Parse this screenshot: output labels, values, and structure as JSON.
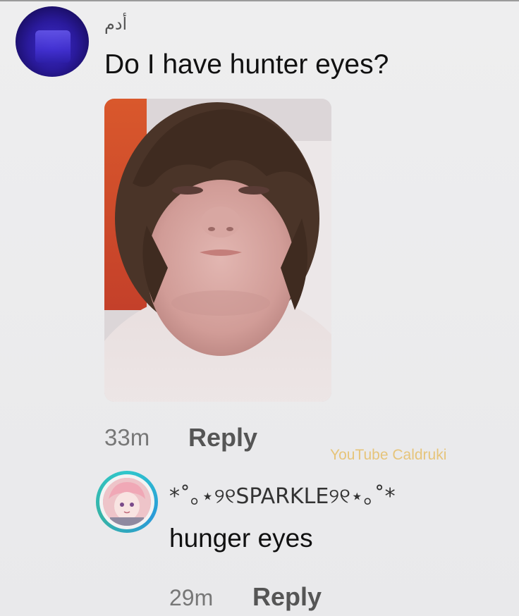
{
  "main_comment": {
    "username": "أدم",
    "text": "Do I have hunter eyes?",
    "timestamp": "33m",
    "reply_label": "Reply"
  },
  "watermark": "YouTube Caldruki",
  "reply_comment": {
    "username": "*˚｡⋆୨୧SPARKLE୨୧⋆｡˚*",
    "text": "hunger eyes",
    "timestamp": "29m",
    "reply_label": "Reply"
  },
  "colors": {
    "background": "#eeeeef",
    "main_avatar": "#2a1a9c",
    "reply_ring": "#2fc7cc",
    "watermark": "#e6c47a"
  }
}
